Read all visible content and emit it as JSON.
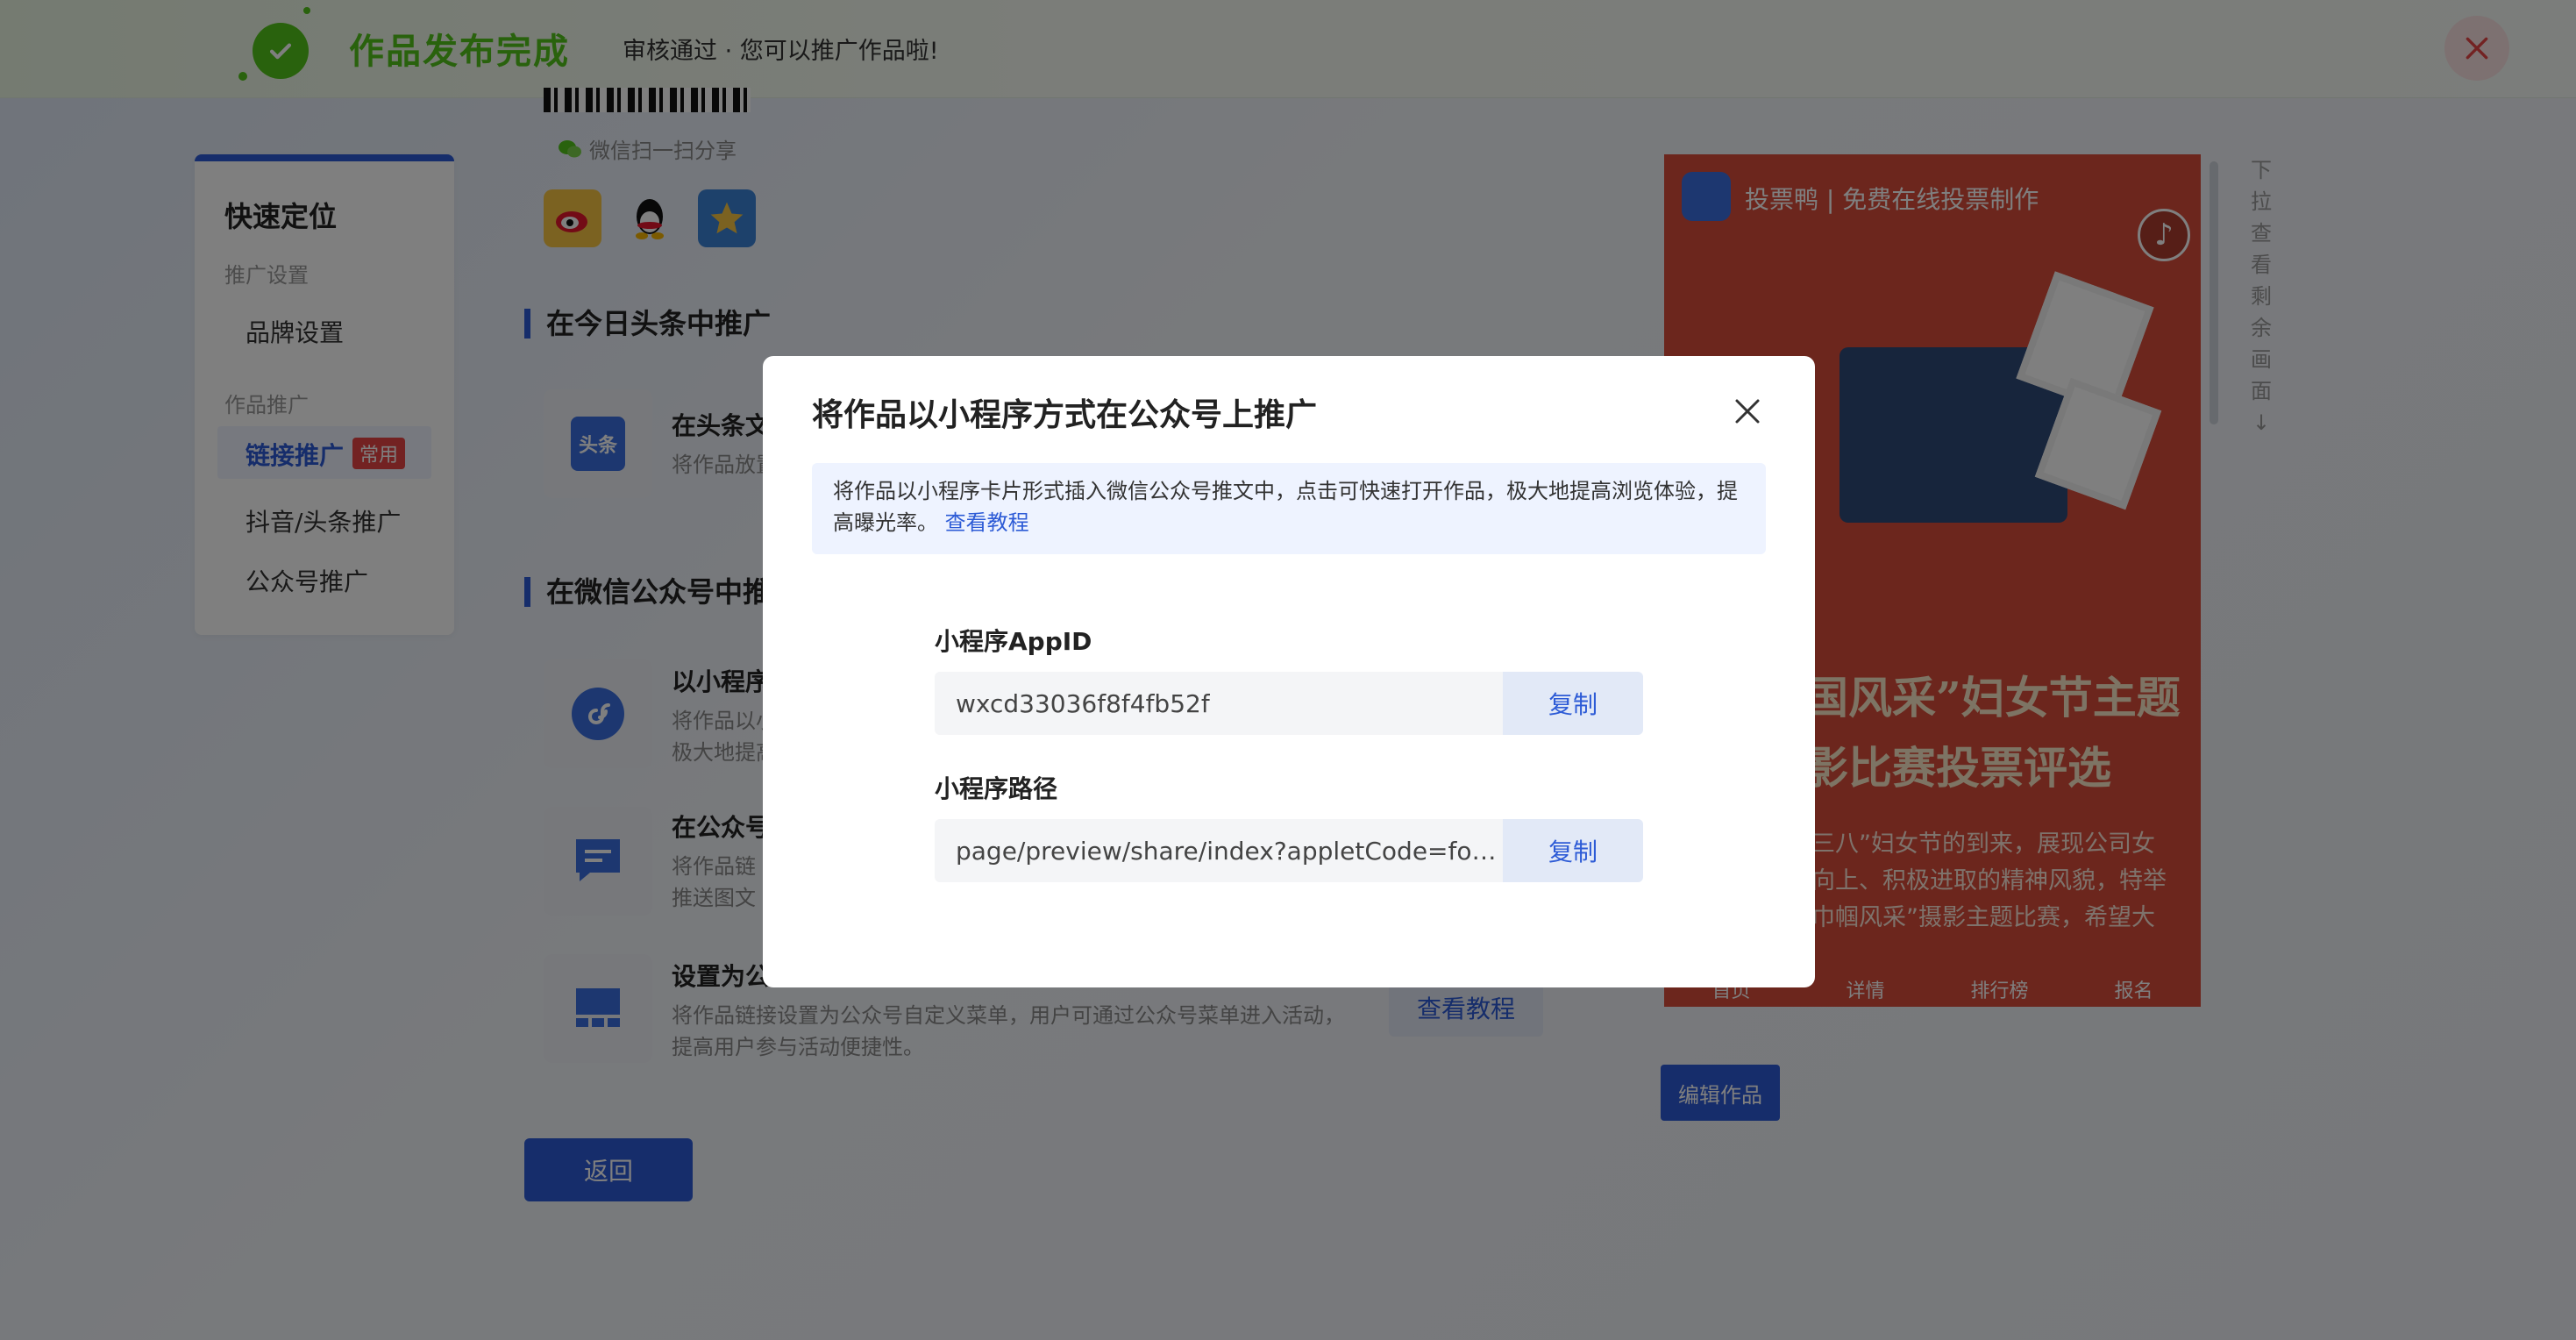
{
  "banner": {
    "title": "作品发布完成",
    "subtitle": "审核通过 · 您可以推广作品啦!"
  },
  "sidebar": {
    "title": "快速定位",
    "group1": "推广设置",
    "brand": "品牌设置",
    "group2": "作品推广",
    "link_promo": "链接推广",
    "link_badge": "常用",
    "douyin": "抖音/头条推广",
    "gzh": "公众号推广"
  },
  "main": {
    "wechat_share": "微信扫一扫分享",
    "section1": "在今日头条中推广",
    "row1_title": "在头条文",
    "row1_desc": "将作品放置",
    "toutiao_icon_text": "头条",
    "section2": "在微信公众号中推",
    "row2_title": "以小程序",
    "row2_desc1": "将作品以小",
    "row2_desc2": "极大地提高",
    "row3_title": "在公众号",
    "row3_desc1": "将作品链",
    "row3_desc2": "推送图文",
    "row4_title": "设置为公",
    "row4_desc1": "将作品链接设置为公众号自定义菜单，用户可通过公众号菜单进入活动，",
    "row4_desc2": "提高用户参与活动便捷性。",
    "tutorial": "查看教程",
    "back": "返回"
  },
  "preview": {
    "brand": "投票鸭 | 免费在线投票制作",
    "headline1": "国风采”妇女节主题",
    "headline2": "影比赛投票评选",
    "text1": "三八”妇女节的到来，展现公司女",
    "text2": "向上、积极进取的精神风貌，特举",
    "text3": "巾帼风采”摄影主题比赛，希望大",
    "nav": [
      "首页",
      "详情",
      "排行榜",
      "报名"
    ],
    "scroll_hint": "下拉查看剩余画面",
    "edit": "编辑作品"
  },
  "modal": {
    "title": "将作品以小程序方式在公众号上推广",
    "info": "将作品以小程序卡片形式插入微信公众号推文中，点击可快速打开作品，极大地提高浏览体验，提高曝光率。",
    "info_link": "查看教程",
    "appid_label": "小程序AppID",
    "appid_value": "wxcd33036f8f4fb52f",
    "path_label": "小程序路径",
    "path_value": "page/preview/share/index?appletCode=for...",
    "copy": "复制"
  },
  "colors": {
    "primary": "#2d5bd6",
    "success": "#52c41a",
    "danger": "#e64545"
  }
}
